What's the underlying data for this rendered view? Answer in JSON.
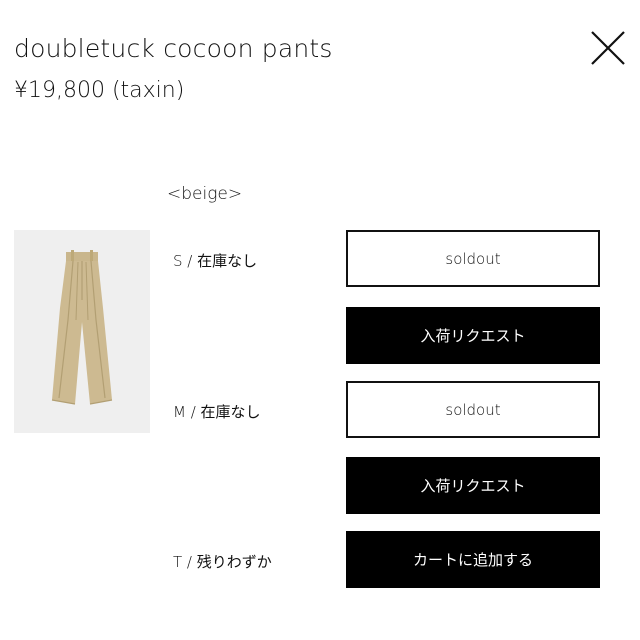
{
  "product": {
    "title": "doubletuck cocoon pants",
    "price": "¥19,800 (taxin)",
    "color": "<beige>",
    "image_icon": "pants-icon"
  },
  "header": {
    "close_icon": "close-icon"
  },
  "sizes": [
    {
      "label": "S / 在庫なし",
      "buttons": [
        {
          "label": "soldout",
          "style": "outline"
        },
        {
          "label": "入荷リクエスト",
          "style": "solid"
        }
      ]
    },
    {
      "label": "M / 在庫なし",
      "buttons": [
        {
          "label": "soldout",
          "style": "outline"
        },
        {
          "label": "入荷リクエスト",
          "style": "solid"
        }
      ]
    },
    {
      "label": "T / 残りわずか",
      "buttons": [
        {
          "label": "カートに追加する",
          "style": "solid"
        }
      ]
    }
  ],
  "colors": {
    "text": "#111111",
    "button_solid_bg": "#000000",
    "button_solid_text": "#ffffff",
    "image_bg": "#efefef",
    "product_beige": "#cbb88e"
  }
}
